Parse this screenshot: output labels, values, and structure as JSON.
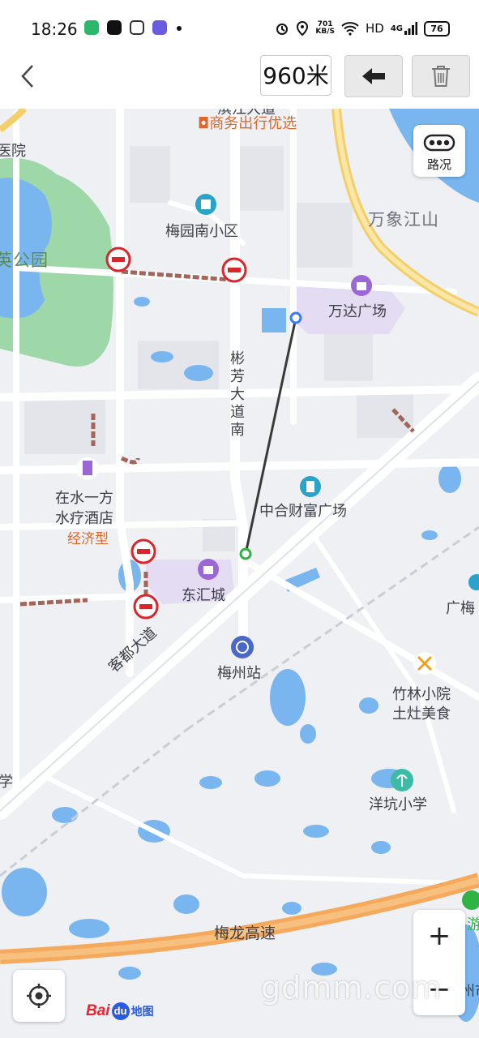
{
  "status_bar": {
    "time": "18:26",
    "net_speed_value": "701",
    "net_speed_unit": "KB/S",
    "hd": "HD",
    "signal": "4G",
    "battery": "76"
  },
  "toolbar": {
    "distance": "960米",
    "back_icon": "chevron-left-icon",
    "undo_icon": "arrow-left-icon",
    "clear_icon": "trash-icon"
  },
  "map_controls": {
    "traffic_label": "路况",
    "zoom_in": "+",
    "zoom_out": "−",
    "locate_icon": "crosshair-icon"
  },
  "map_labels": {
    "top_cut": "滨江大道",
    "business_tag": "商务出行优选",
    "meiyuan": "梅园南小区",
    "wanxiang": "万象江山",
    "park": "英公园",
    "wanda": "万达广场",
    "road_binfang": "彬芳大道南",
    "hotel_line1": "在水一方",
    "hotel_line2": "水疗酒店",
    "hotel_tag": "经济型",
    "zhonghe": "中合财富广场",
    "donghui": "东汇城",
    "guangmei": "广梅",
    "kedu": "客都大道",
    "station": "梅州站",
    "zhulin_line1": "竹林小院",
    "zhulin_line2": "土灶美食",
    "yangkeng": "洋坑小学",
    "school_left": "学",
    "yuan": "医院",
    "meilong": "梅龙高速",
    "you": "游",
    "right_cut": "州市"
  },
  "logo": {
    "bai": "Bai",
    "du": "du",
    "ditu": "地图"
  },
  "watermark": "gdmm.com",
  "colors": {
    "water": "#79b6f0",
    "park": "#9ed8a8",
    "highway": "#f5a95c",
    "measure_line": "#3a3a3a",
    "start_point": "#3b7df0",
    "end_point": "#2fb344",
    "no_entry": "#d9262c"
  }
}
